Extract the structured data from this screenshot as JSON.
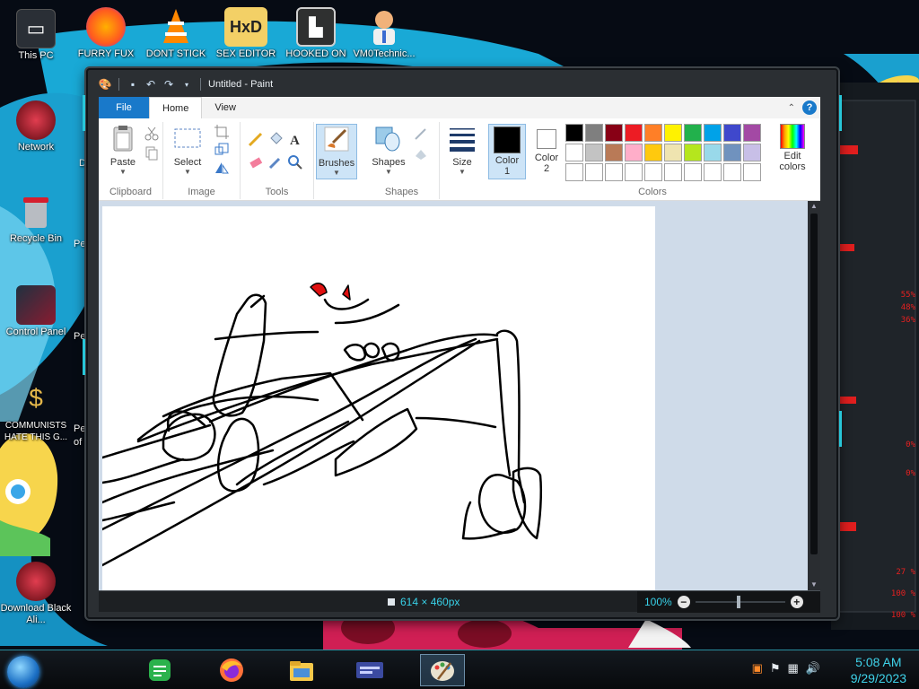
{
  "desktop": {
    "icons": [
      {
        "label": "This PC",
        "icon": "computer-icon"
      },
      {
        "label": "FURRY FUX",
        "icon": "firefox-icon"
      },
      {
        "label": "DONT STICK",
        "icon": "vlc-icon"
      },
      {
        "label": "SEX EDITOR",
        "icon": "hxd-icon"
      },
      {
        "label": "HOOKED ON",
        "icon": "game-icon"
      },
      {
        "label": "VM0Technic...",
        "icon": "doctor-icon"
      },
      {
        "label": "Network",
        "icon": "network-icon"
      },
      {
        "label": "Recycle Bin",
        "icon": "recycle-bin-icon"
      },
      {
        "label": "Control Panel",
        "icon": "control-panel-icon"
      },
      {
        "label": "COMMUNISTS HATE THIS G...",
        "icon": "money-bag-icon"
      },
      {
        "label": "Download Black Ali...",
        "icon": "download-icon"
      }
    ],
    "partial_labels": [
      "D",
      "Pe",
      "Pe",
      "Pe",
      "of"
    ]
  },
  "paint": {
    "title": "Untitled - Paint",
    "tabs": {
      "file": "File",
      "home": "Home",
      "view": "View"
    },
    "groups": {
      "clipboard": {
        "name": "Clipboard",
        "paste": "Paste"
      },
      "image": {
        "name": "Image",
        "select": "Select"
      },
      "tools": {
        "name": "Tools"
      },
      "brushes": {
        "label": "Brushes"
      },
      "shapes": {
        "name": "Shapes",
        "label": "Shapes"
      },
      "size": {
        "label": "Size"
      },
      "colors": {
        "name": "Colors",
        "color1": "Color",
        "color1_num": "1",
        "color2": "Color",
        "color2_num": "2",
        "edit_line1": "Edit",
        "edit_line2": "colors"
      }
    },
    "palette_row1": [
      "#000000",
      "#7f7f7f",
      "#880015",
      "#ed1c24",
      "#ff7f27",
      "#fff200",
      "#22b14c",
      "#00a2e8",
      "#3f48cc",
      "#a349a4"
    ],
    "palette_row2": [
      "#ffffff",
      "#c3c3c3",
      "#b97a57",
      "#ffaec9",
      "#ffc90e",
      "#efe4b0",
      "#b5e61d",
      "#99d9ea",
      "#7092be",
      "#c8bfe7"
    ],
    "palette_row3": [
      "#ffffff",
      "#ffffff",
      "#ffffff",
      "#ffffff",
      "#ffffff",
      "#ffffff",
      "#ffffff",
      "#ffffff",
      "#ffffff",
      "#ffffff"
    ],
    "color1_value": "#000000",
    "color2_value": "#ffffff",
    "status": {
      "dimensions": "614 × 460px",
      "zoom": "100%"
    }
  },
  "gadget": {
    "readouts": [
      "55%",
      "48%",
      "36%",
      "0%",
      "0%",
      "27 %",
      "100 %",
      "100 %"
    ]
  },
  "taskbar": {
    "apps": [
      "notes-icon",
      "firefox-icon",
      "file-explorer-icon",
      "media-icon",
      "paint-icon"
    ],
    "time": "5:08 AM",
    "date": "9/29/2023"
  }
}
